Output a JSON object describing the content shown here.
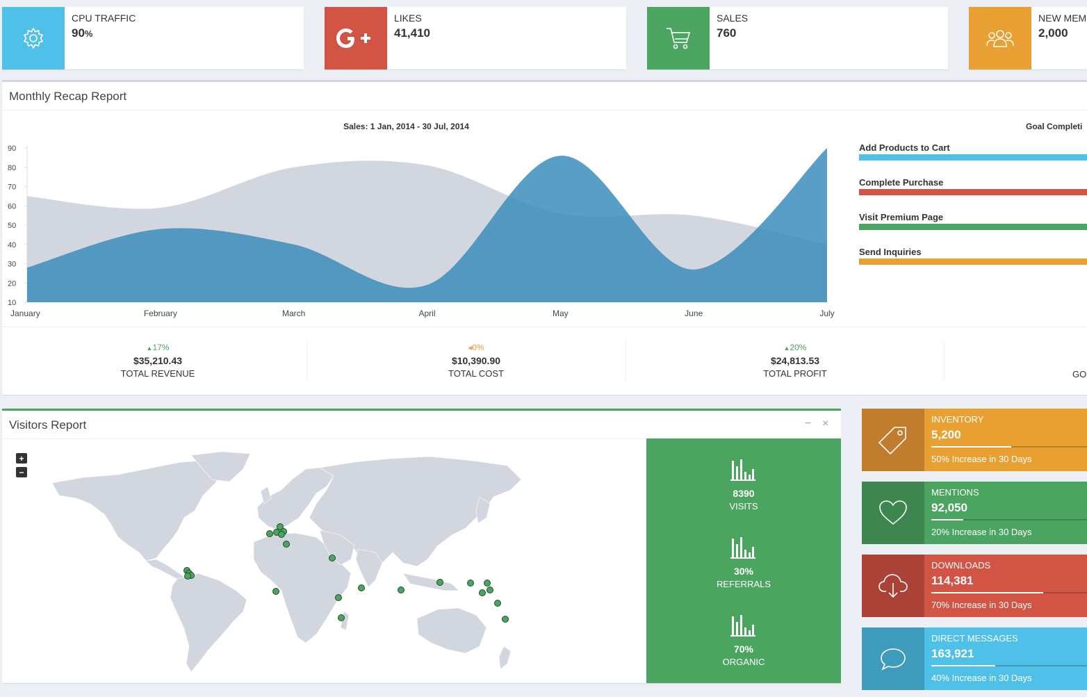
{
  "info_boxes": [
    {
      "label": "CPU TRAFFIC",
      "value": "90",
      "unit": "%",
      "color": "#4fc1e9",
      "icon": "gear-icon"
    },
    {
      "label": "LIKES",
      "value": "41,410",
      "color": "#d25444",
      "icon": "google-plus-icon"
    },
    {
      "label": "SALES",
      "value": "760",
      "color": "#4ba460",
      "icon": "cart-icon"
    },
    {
      "label": "NEW MEMBE",
      "value": "2,000",
      "color": "#e8a033",
      "icon": "users-icon"
    }
  ],
  "recap": {
    "title": "Monthly Recap Report",
    "goal_title": "Goal Completi",
    "goals": [
      {
        "label": "Add Products to Cart",
        "color": "#4fc1e9"
      },
      {
        "label": "Complete Purchase",
        "color": "#d25444"
      },
      {
        "label": "Visit Premium Page",
        "color": "#4ba460"
      },
      {
        "label": "Send Inquiries",
        "color": "#e8a033"
      }
    ],
    "stats": [
      {
        "pct": "17%",
        "arrow": "▲",
        "amount": "$35,210.43",
        "label": "TOTAL REVENUE",
        "color": "#4ba460"
      },
      {
        "pct": "0%",
        "arrow": "◂",
        "amount": "$10,390.90",
        "label": "TOTAL COST",
        "color": "#e8a033"
      },
      {
        "pct": "20%",
        "arrow": "▲",
        "amount": "$24,813.53",
        "label": "TOTAL PROFIT",
        "color": "#4ba460"
      },
      {
        "pct": "",
        "arrow": "",
        "amount": "",
        "label": "GO",
        "color": "#4ba460"
      }
    ]
  },
  "chart_data": {
    "type": "area",
    "title": "Sales: 1 Jan, 2014 - 30 Jul, 2014",
    "categories": [
      "January",
      "February",
      "March",
      "April",
      "May",
      "June",
      "July"
    ],
    "ylim": [
      10,
      90
    ],
    "yticks": [
      10,
      20,
      30,
      40,
      50,
      60,
      70,
      80,
      90
    ],
    "series": [
      {
        "values": [
          65,
          59,
          80,
          81,
          56,
          55,
          40
        ],
        "color": "#d2d6de"
      },
      {
        "values": [
          28,
          48,
          40,
          19,
          86,
          27,
          90
        ],
        "color": "#3c8dbc"
      }
    ]
  },
  "visitors": {
    "title": "Visitors Report",
    "zoom_in": "+",
    "zoom_out": "−",
    "minimize": "−",
    "close": "×",
    "stats": [
      {
        "value": "8390",
        "label": "VISITS"
      },
      {
        "value": "30%",
        "label": "REFERRALS"
      },
      {
        "value": "70%",
        "label": "ORGANIC"
      }
    ]
  },
  "side_boxes": [
    {
      "label": "INVENTORY",
      "value": "5,200",
      "progress": 0.5,
      "desc": "50% Increase in 30 Days",
      "color": "#e8a033",
      "dark": "#c07d2d",
      "icon": "tag-icon"
    },
    {
      "label": "MENTIONS",
      "value": "92,050",
      "progress": 0.2,
      "desc": "20% Increase in 30 Days",
      "color": "#4ba460",
      "dark": "#3d8650",
      "icon": "heart-icon"
    },
    {
      "label": "DOWNLOADS",
      "value": "114,381",
      "progress": 0.7,
      "desc": "70% Increase in 30 Days",
      "color": "#d25444",
      "dark": "#aa4237",
      "icon": "cloud-download-icon"
    },
    {
      "label": "DIRECT MESSAGES",
      "value": "163,921",
      "progress": 0.4,
      "desc": "40% Increase in 30 Days",
      "color": "#4fc1e9",
      "dark": "#3e9bbc",
      "icon": "chat-icon"
    }
  ]
}
